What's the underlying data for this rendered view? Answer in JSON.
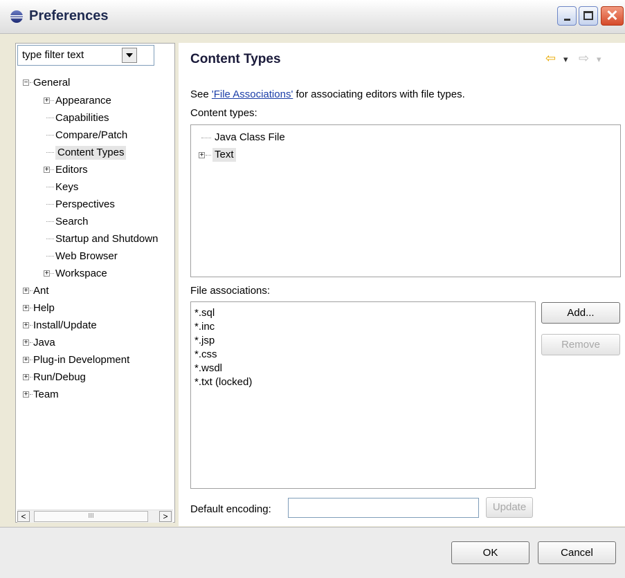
{
  "window": {
    "title": "Preferences"
  },
  "filter": {
    "value": "type filter text"
  },
  "tree": [
    {
      "label": "General",
      "expander": "−"
    },
    {
      "label": "Appearance",
      "expander": "+"
    },
    {
      "label": "Capabilities",
      "expander": ""
    },
    {
      "label": "Compare/Patch",
      "expander": ""
    },
    {
      "label": "Content Types",
      "expander": ""
    },
    {
      "label": "Editors",
      "expander": "+"
    },
    {
      "label": "Keys",
      "expander": ""
    },
    {
      "label": "Perspectives",
      "expander": ""
    },
    {
      "label": "Search",
      "expander": ""
    },
    {
      "label": "Startup and Shutdown",
      "expander": ""
    },
    {
      "label": "Web Browser",
      "expander": ""
    },
    {
      "label": "Workspace",
      "expander": "+"
    },
    {
      "label": "Ant",
      "expander": "+"
    },
    {
      "label": "Help",
      "expander": "+"
    },
    {
      "label": "Install/Update",
      "expander": "+"
    },
    {
      "label": "Java",
      "expander": "+"
    },
    {
      "label": "Plug-in Development",
      "expander": "+"
    },
    {
      "label": "Run/Debug",
      "expander": "+"
    },
    {
      "label": "Team",
      "expander": "+"
    }
  ],
  "scrollbar": {
    "thumb_grip": "III",
    "left_arrow": "<",
    "right_arrow": ">"
  },
  "page": {
    "title": "Content Types",
    "intro_prefix": "See ",
    "intro_link": "'File Associations'",
    "intro_suffix": " for associating editors with file types.",
    "content_types_label": "Content types:",
    "content_types": [
      {
        "label": "Java Class File",
        "expander": ""
      },
      {
        "label": "Text",
        "expander": "+"
      }
    ],
    "file_associations_label": "File associations:",
    "file_associations": [
      "*.sql",
      "*.inc",
      "*.jsp",
      "*.css",
      "*.wsdl",
      "*.txt (locked)"
    ],
    "add_button": "Add...",
    "remove_button": "Remove",
    "default_encoding_label": "Default encoding:",
    "default_encoding_value": "",
    "update_button": "Update"
  },
  "nav": {
    "back_icon": "⇦",
    "forward_icon": "⇨",
    "dropdown_icon": "▾"
  },
  "footer": {
    "ok": "OK",
    "cancel": "Cancel"
  }
}
